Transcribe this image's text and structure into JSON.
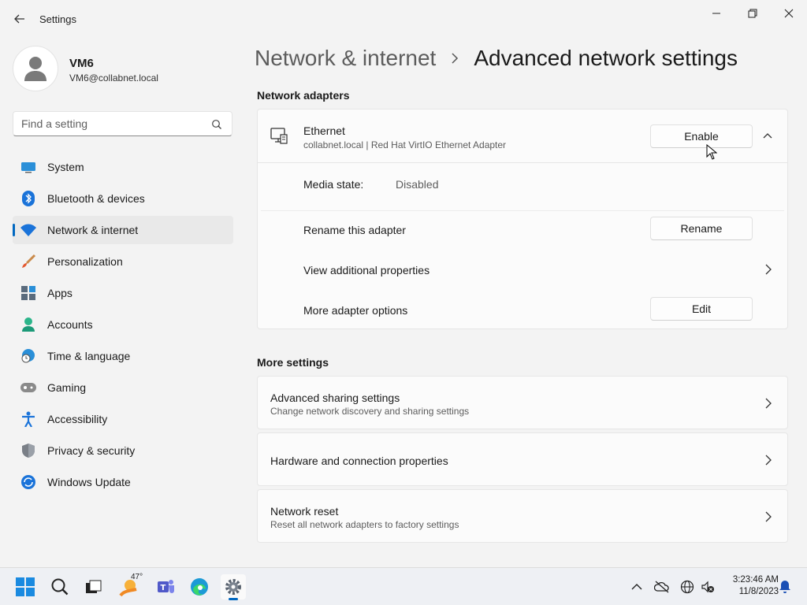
{
  "window": {
    "title": "Settings"
  },
  "profile": {
    "name": "VM6",
    "email": "VM6@collabnet.local"
  },
  "search": {
    "placeholder": "Find a setting"
  },
  "sidebar": {
    "items": [
      {
        "label": "System",
        "icon": "system-icon"
      },
      {
        "label": "Bluetooth & devices",
        "icon": "bluetooth-icon"
      },
      {
        "label": "Network & internet",
        "icon": "wifi-icon",
        "active": true
      },
      {
        "label": "Personalization",
        "icon": "paintbrush-icon"
      },
      {
        "label": "Apps",
        "icon": "apps-icon"
      },
      {
        "label": "Accounts",
        "icon": "person-icon"
      },
      {
        "label": "Time & language",
        "icon": "globe-clock-icon"
      },
      {
        "label": "Gaming",
        "icon": "gamepad-icon"
      },
      {
        "label": "Accessibility",
        "icon": "accessibility-icon"
      },
      {
        "label": "Privacy & security",
        "icon": "shield-icon"
      },
      {
        "label": "Windows Update",
        "icon": "update-icon"
      }
    ]
  },
  "breadcrumb": {
    "parent": "Network & internet",
    "current": "Advanced network settings"
  },
  "adapters": {
    "section_title": "Network adapters",
    "ethernet": {
      "name": "Ethernet",
      "description": "collabnet.local | Red Hat VirtIO Ethernet Adapter",
      "enable_label": "Enable",
      "media_state_label": "Media state:",
      "media_state_value": "Disabled",
      "rename_label": "Rename this adapter",
      "rename_button": "Rename",
      "view_props_label": "View additional properties",
      "more_options_label": "More adapter options",
      "edit_button": "Edit"
    }
  },
  "more_settings": {
    "section_title": "More settings",
    "items": [
      {
        "title": "Advanced sharing settings",
        "subtitle": "Change network discovery and sharing settings"
      },
      {
        "title": "Hardware and connection properties",
        "subtitle": ""
      },
      {
        "title": "Network reset",
        "subtitle": "Reset all network adapters to factory settings"
      }
    ]
  },
  "taskbar": {
    "weather_temp": "47°",
    "time": "3:23:46 AM",
    "date": "11/8/2023"
  },
  "colors": {
    "accent": "#0067c0",
    "background": "#f3f3f3",
    "card": "#fbfbfb"
  }
}
